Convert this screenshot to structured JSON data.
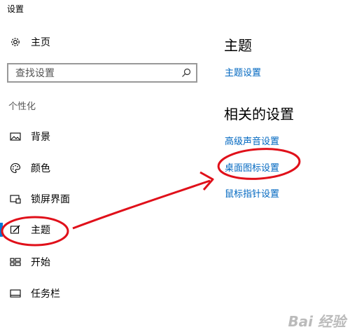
{
  "window": {
    "title": "设置"
  },
  "sidebar": {
    "home": {
      "label": "主页",
      "icon": "gear-icon"
    },
    "search": {
      "placeholder": "查找设置",
      "icon": "search-icon"
    },
    "section_title": "个性化",
    "items": [
      {
        "label": "背景",
        "icon": "picture-icon",
        "active": false
      },
      {
        "label": "颜色",
        "icon": "palette-icon",
        "active": false
      },
      {
        "label": "锁屏界面",
        "icon": "lock-screen-icon",
        "active": false
      },
      {
        "label": "主题",
        "icon": "theme-brush-icon",
        "active": true
      },
      {
        "label": "开始",
        "icon": "start-menu-icon",
        "active": false
      },
      {
        "label": "任务栏",
        "icon": "taskbar-icon",
        "active": false
      }
    ]
  },
  "main": {
    "heading": "主题",
    "theme_settings_link": "主题设置",
    "related_heading": "相关的设置",
    "related_links": [
      "高级声音设置",
      "桌面图标设置",
      "鼠标指针设置"
    ]
  },
  "watermark": {
    "text": "Bai 经验"
  },
  "colors": {
    "accent": "#0078d7",
    "link": "#0067c0",
    "annotation": "#e0101a"
  }
}
